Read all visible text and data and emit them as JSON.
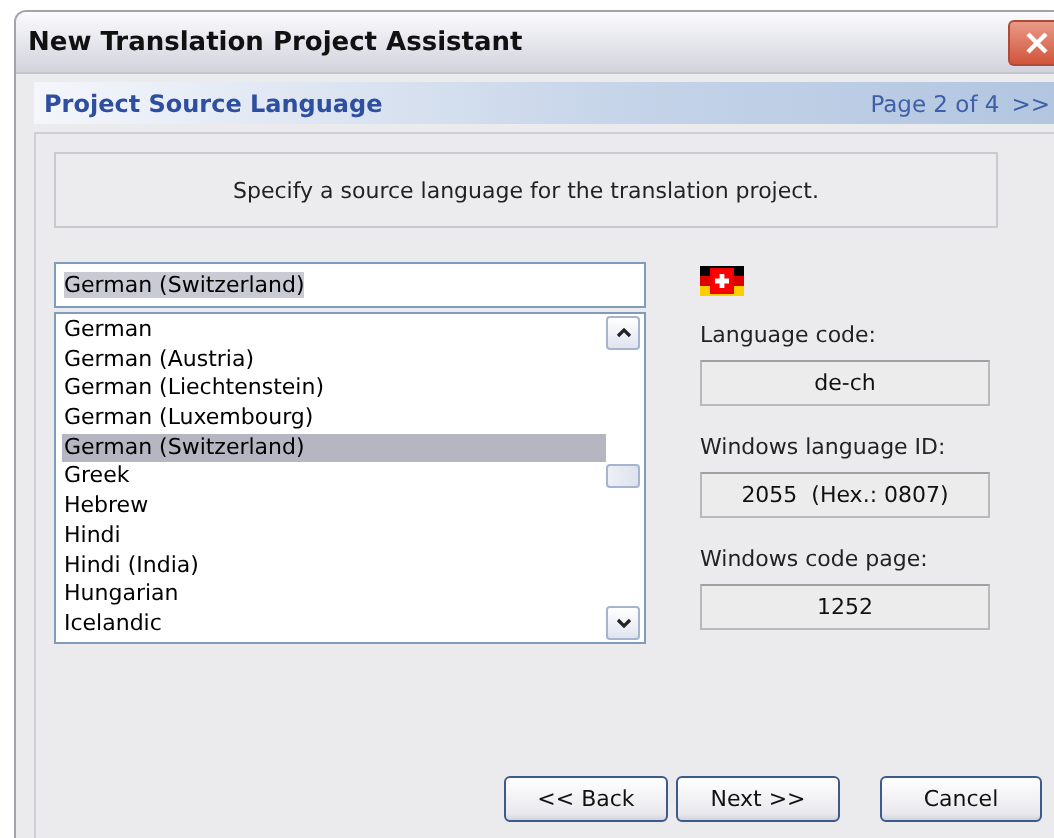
{
  "window": {
    "title": "New Translation Project Assistant"
  },
  "header": {
    "title": "Project Source Language",
    "page": "Page 2 of 4",
    "next_arrow": ">>"
  },
  "instruction": "Specify a source language for the translation project.",
  "language_search": {
    "value": "German (Switzerland)",
    "text_selected": true
  },
  "languages": [
    {
      "label": "German",
      "selected": false
    },
    {
      "label": "German (Austria)",
      "selected": false
    },
    {
      "label": "German (Liechtenstein)",
      "selected": false
    },
    {
      "label": "German (Luxembourg)",
      "selected": false
    },
    {
      "label": "German (Switzerland)",
      "selected": true
    },
    {
      "label": "Greek",
      "selected": false
    },
    {
      "label": "Hebrew",
      "selected": false
    },
    {
      "label": "Hindi",
      "selected": false
    },
    {
      "label": "Hindi (India)",
      "selected": false
    },
    {
      "label": "Hungarian",
      "selected": false
    },
    {
      "label": "Icelandic",
      "selected": false
    }
  ],
  "details": [
    {
      "label": "Language code:",
      "value": "de-ch"
    },
    {
      "label": "Windows language ID:",
      "value": "2055  (Hex.: 0807)"
    },
    {
      "label": "Windows code page:",
      "value": "1252"
    }
  ],
  "buttons": [
    {
      "label": "<< Back"
    },
    {
      "label": "Next >>"
    },
    {
      "label": "Cancel"
    }
  ]
}
